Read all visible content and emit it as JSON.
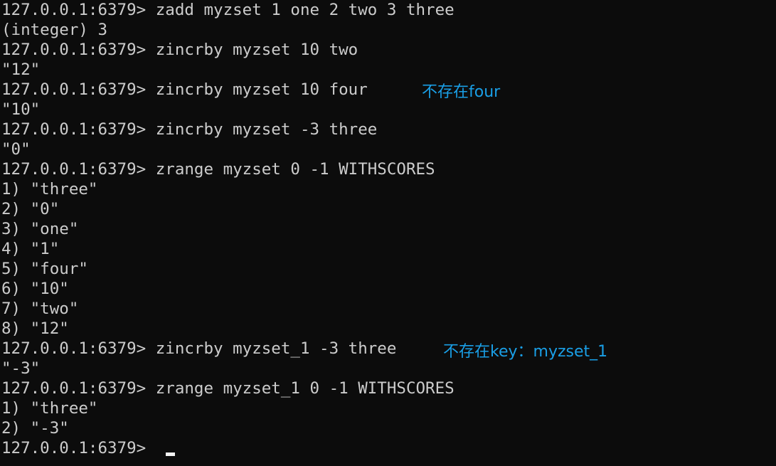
{
  "terminal": {
    "prompt": "127.0.0.1:6379>",
    "lines": [
      {
        "kind": "cmd",
        "text": "zadd myzset 1 one 2 two 3 three"
      },
      {
        "kind": "out",
        "text": "(integer) 3"
      },
      {
        "kind": "cmd",
        "text": "zincrby myzset 10 two"
      },
      {
        "kind": "out",
        "text": "\"12\""
      },
      {
        "kind": "cmd",
        "text": "zincrby myzset 10 four"
      },
      {
        "kind": "out",
        "text": "\"10\""
      },
      {
        "kind": "cmd",
        "text": "zincrby myzset -3 three"
      },
      {
        "kind": "out",
        "text": "\"0\""
      },
      {
        "kind": "cmd",
        "text": "zrange myzset 0 -1 WITHSCORES"
      },
      {
        "kind": "out",
        "text": "1) \"three\""
      },
      {
        "kind": "out",
        "text": "2) \"0\""
      },
      {
        "kind": "out",
        "text": "3) \"one\""
      },
      {
        "kind": "out",
        "text": "4) \"1\""
      },
      {
        "kind": "out",
        "text": "5) \"four\""
      },
      {
        "kind": "out",
        "text": "6) \"10\""
      },
      {
        "kind": "out",
        "text": "7) \"two\""
      },
      {
        "kind": "out",
        "text": "8) \"12\""
      },
      {
        "kind": "cmd",
        "text": "zincrby myzset_1 -3 three"
      },
      {
        "kind": "out",
        "text": "\"-3\""
      },
      {
        "kind": "cmd",
        "text": "zrange myzset_1 0 -1 WITHSCORES"
      },
      {
        "kind": "out",
        "text": "1) \"three\""
      },
      {
        "kind": "out",
        "text": "2) \"-3\""
      },
      {
        "kind": "cmd",
        "text": ""
      }
    ]
  },
  "annotations": {
    "note_four": "不存在four",
    "note_key": "不存在key：myzset_1"
  },
  "colors": {
    "background": "#0c0c0c",
    "text": "#cccccc",
    "annotation": "#1a9fe6"
  }
}
